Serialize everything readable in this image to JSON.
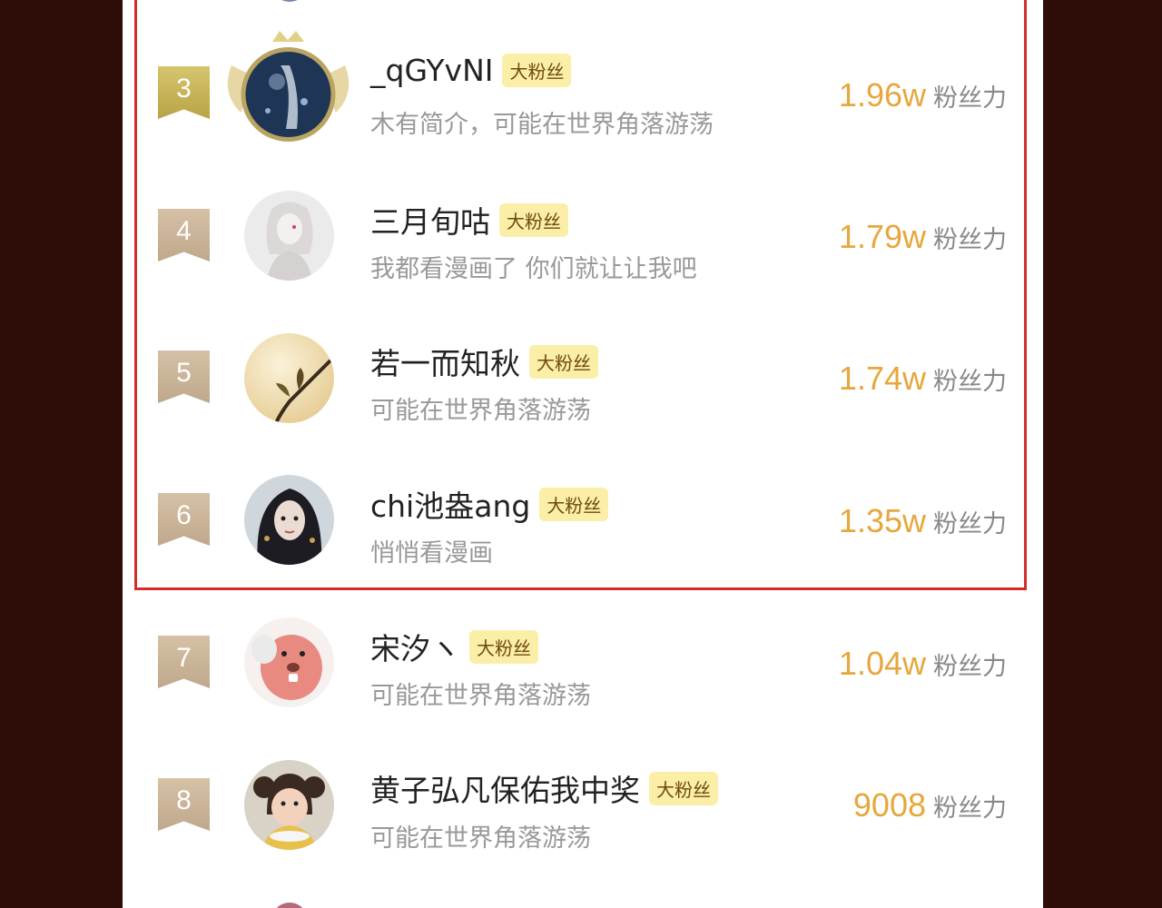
{
  "badge_label": "大粉丝",
  "score_unit": "粉丝力",
  "colors": {
    "accent": "#e6a73c",
    "highlight_border": "#d42b2b",
    "badge_bg": "#fbeea6",
    "page_bg": "#2e0c08"
  },
  "rows": [
    {
      "rank": "3",
      "name": "_qGYvNI",
      "bio": "木有简介，可能在世界角落游荡",
      "score": "1.96w",
      "avatar": "avatar-crown-icon"
    },
    {
      "rank": "4",
      "name": "三月旬咕",
      "bio": "我都看漫画了 你们就让让我吧",
      "score": "1.79w",
      "avatar": "avatar-sketch-icon"
    },
    {
      "rank": "5",
      "name": "若一而知秋",
      "bio": "可能在世界角落游荡",
      "score": "1.74w",
      "avatar": "avatar-branch-icon"
    },
    {
      "rank": "6",
      "name": "chi池盎ang",
      "bio": "悄悄看漫画",
      "score": "1.35w",
      "avatar": "avatar-girl-icon"
    },
    {
      "rank": "7",
      "name": "宋汐ヽ",
      "bio": "可能在世界角落游荡",
      "score": "1.04w",
      "avatar": "avatar-beaver-icon"
    },
    {
      "rank": "8",
      "name": "黄子弘凡保佑我中奖",
      "bio": "可能在世界角落游荡",
      "score": "9008",
      "avatar": "avatar-child-icon"
    }
  ]
}
